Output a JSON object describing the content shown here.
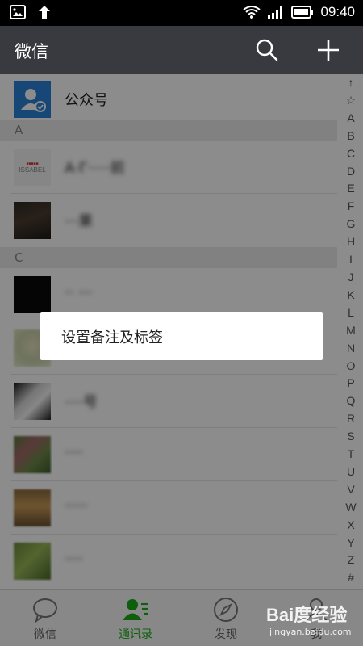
{
  "status_bar": {
    "time": "09:40",
    "icons": [
      "image-icon",
      "upload-arrow-icon",
      "wifi-icon",
      "signal-icon",
      "battery-icon"
    ]
  },
  "title_bar": {
    "title": "微信",
    "actions": [
      "search-icon",
      "plus-icon"
    ]
  },
  "contacts": {
    "official_accounts": "公众号",
    "sections": [
      {
        "letter": "A",
        "items": [
          {
            "name": "A·Γ·····前",
            "avatar_text": "ISSABEL"
          },
          {
            "name": "···果"
          }
        ]
      },
      {
        "letter": "C",
        "items": [
          {
            "name": "·· ···"
          },
          {
            "name": ""
          },
          {
            "name": "····号"
          },
          {
            "name": "····"
          },
          {
            "name": "·····"
          },
          {
            "name": "····"
          }
        ]
      }
    ]
  },
  "alphabet_index": [
    "↑",
    "☆",
    "A",
    "B",
    "C",
    "D",
    "E",
    "F",
    "G",
    "H",
    "I",
    "J",
    "K",
    "L",
    "M",
    "N",
    "O",
    "P",
    "Q",
    "R",
    "S",
    "T",
    "U",
    "V",
    "W",
    "X",
    "Y",
    "Z",
    "#"
  ],
  "bottom_nav": {
    "items": [
      {
        "label": "微信",
        "icon": "chat-bubble-icon",
        "active": false
      },
      {
        "label": "通讯录",
        "icon": "contacts-icon",
        "active": true
      },
      {
        "label": "发现",
        "icon": "compass-icon",
        "active": false
      },
      {
        "label": "我",
        "icon": "person-icon",
        "active": false
      }
    ]
  },
  "dialog": {
    "item_label": "设置备注及标签"
  },
  "watermark": {
    "logo": "Bai度经验",
    "url": "jingyan.baidu.com"
  },
  "colors": {
    "title_bar_bg": "#393a3f",
    "accent_green": "#1aad19",
    "section_header_bg": "#ececec"
  }
}
